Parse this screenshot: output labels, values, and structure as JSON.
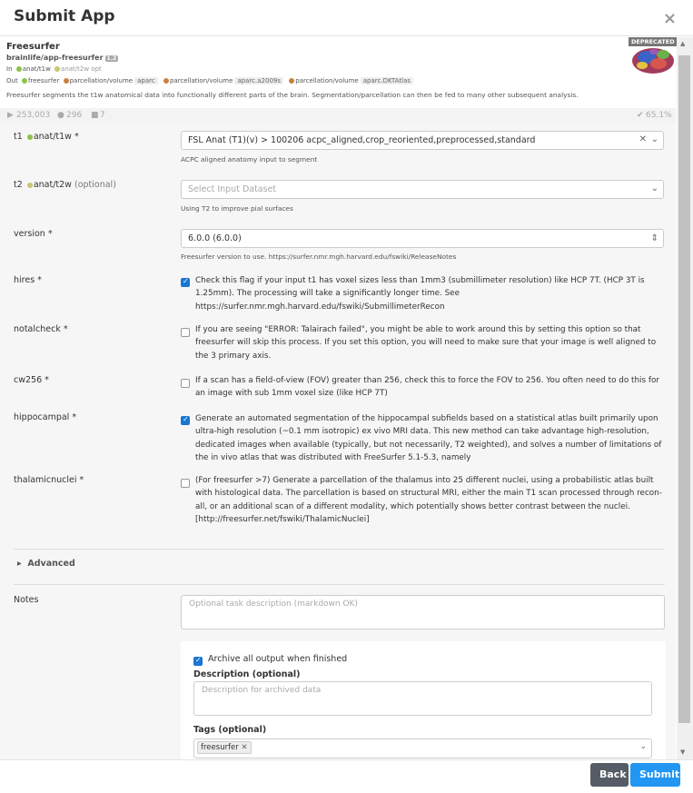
{
  "modal": {
    "title": "Submit App",
    "close_label": "×"
  },
  "app": {
    "name": "Freesurfer",
    "repo": "brainlife/app-freesurfer",
    "version_badge": "1.2",
    "inputs_prefix": "In",
    "input_1": "anat/t1w",
    "input_2": "anat/t2w opt",
    "outputs_prefix": "Out",
    "output_1": "freesurfer",
    "output_2": "parcellation/volume",
    "output_2_tag": "aparc",
    "output_3": "parcellation/volume",
    "output_3_tag": "aparc.a2009s",
    "output_4": "parcellation/volume",
    "output_4_tag": "aparc.DKTAtlas",
    "description": "Freesurfer segments the t1w anatomical data into functionally different parts of the brain. Segmentation/parcellation can then be fed to many other subsequent analysis.",
    "deprecated_label": "DEPRECATED"
  },
  "stats": {
    "runs": "253,003",
    "users": "296",
    "stars": "7",
    "success_rate": "65.1%"
  },
  "form": {
    "t1": {
      "label": "t1",
      "datatype": "anat/t1w",
      "required": "*",
      "value": "FSL Anat (T1)(v) > 100206 acpc_aligned,crop_reoriented,preprocessed,standard",
      "help": "ACPC aligned anatomy input to segment"
    },
    "t2": {
      "label": "t2",
      "datatype": "anat/t2w",
      "optional": "(optional)",
      "placeholder": "Select Input Dataset",
      "help": "Using T2 to improve pial surfaces"
    },
    "version": {
      "label": "version *",
      "value": "6.0.0 (6.0.0)",
      "help": "Freesurfer version to use. https://surfer.nmr.mgh.harvard.edu/fswiki/ReleaseNotes"
    },
    "hires": {
      "label": "hires *",
      "checked": true,
      "text": "Check this flag if your input t1 has voxel sizes less than 1mm3 (submillimeter resolution) like HCP 7T. (HCP 3T is 1.25mm). The processing will take a significantly longer time. See https://surfer.nmr.mgh.harvard.edu/fswiki/SubmillimeterRecon"
    },
    "notalcheck": {
      "label": "notalcheck *",
      "checked": false,
      "text": "If you are seeing \"ERROR: Talairach failed\", you might be able to work around this by setting this option so that freesurfer will skip this process. If you set this option, you will need to make sure that your image is well aligned to the 3 primary axis."
    },
    "cw256": {
      "label": "cw256 *",
      "checked": false,
      "text": "If a scan has a field-of-view (FOV) greater than 256, check this to force the FOV to 256. You often need to do this for an image with sub 1mm voxel size (like HCP 7T)"
    },
    "hippocampal": {
      "label": "hippocampal *",
      "checked": true,
      "text": "Generate an automated segmentation of the hippocampal subfields based on a statistical atlas built primarily upon ultra-high resolution (~0.1 mm isotropic) ex vivo MRI data. This new method can take advantage high-resolution, dedicated images when available (typically, but not necessarily, T2 weighted), and solves a number of limitations of the in vivo atlas that was distributed with FreeSurfer 5.1-5.3, namely"
    },
    "thalamicnuclei": {
      "label": "thalamicnuclei *",
      "checked": false,
      "text": "(For freesurfer >7) Generate a parcellation of the thalamus into 25 different nuclei, using a probabilistic atlas built with histological data. The parcellation is based on structural MRI, either the main T1 scan processed through recon-all, or an additional scan of a different modality, which potentially shows better contrast between the nuclei. [http://freesurfer.net/fswiki/ThalamicNuclei]"
    },
    "advanced_label": "Advanced",
    "notes": {
      "label": "Notes",
      "placeholder": "Optional task description (markdown OK)"
    },
    "archive": {
      "checked": true,
      "label": "Archive all output when finished",
      "description_label": "Description (optional)",
      "description_placeholder": "Description for archived data",
      "tags_label": "Tags (optional)",
      "tag": "freesurfer"
    }
  },
  "footer": {
    "back_label": "Back",
    "submit_label": "Submit"
  },
  "colors": {
    "primary": "#2196f3",
    "back": "#555c66",
    "checkbox": "#1976d2"
  },
  "icons": [
    "close-icon",
    "chevron-down-icon",
    "clear-icon",
    "play-icon",
    "user-icon",
    "star-icon",
    "check-circle-icon",
    "caret-right-icon",
    "updown-icon"
  ]
}
